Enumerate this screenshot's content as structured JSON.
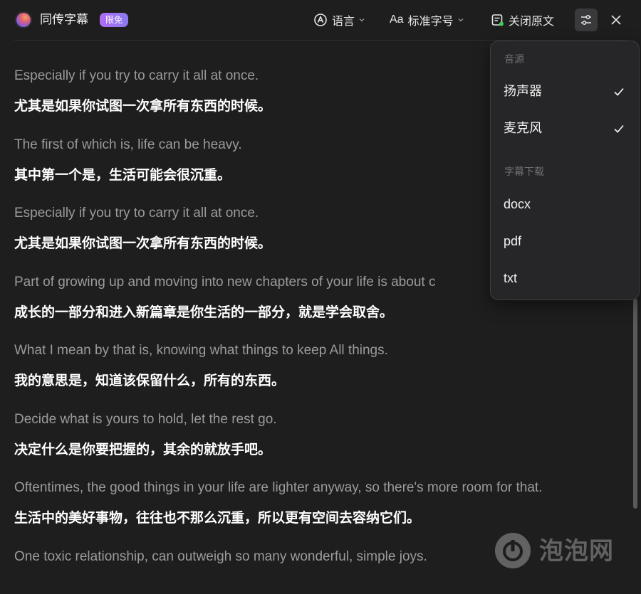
{
  "app": {
    "title": "同传字幕",
    "badge": "限免"
  },
  "toolbar": {
    "language_label": "语言",
    "font_size_label": "标准字号",
    "close_original_label": "关闭原文"
  },
  "subtitles": [
    {
      "en": "Especially if you try to carry it all at once.",
      "zh": "尤其是如果你试图一次拿所有东西的时候。"
    },
    {
      "en": "The first of which is, life can be heavy.",
      "zh": "其中第一个是，生活可能会很沉重。"
    },
    {
      "en": "Especially if you try to carry it all at once.",
      "zh": "尤其是如果你试图一次拿所有东西的时候。"
    },
    {
      "en": "Part of growing up and moving into new chapters of your life is about c",
      "zh": "成长的一部分和进入新篇章是你生活的一部分，就是学会取舍。"
    },
    {
      "en": "What I mean by that is, knowing what things to keep All things.",
      "zh": "我的意思是，知道该保留什么，所有的东西。"
    },
    {
      "en": "Decide what is yours to hold, let the rest go.",
      "zh": "决定什么是你要把握的，其余的就放手吧。"
    },
    {
      "en": "Oftentimes, the good things in your life are lighter anyway, so there's more room for that.",
      "zh": "生活中的美好事物，往往也不那么沉重，所以更有空间去容纳它们。"
    },
    {
      "en": "One toxic relationship, can outweigh so many wonderful, simple joys.",
      "zh": ""
    }
  ],
  "panel": {
    "audio_source_heading": "音源",
    "speaker_label": "扬声器",
    "speaker_checked": true,
    "mic_label": "麦克风",
    "mic_checked": true,
    "download_heading": "字幕下载",
    "docx_label": "docx",
    "pdf_label": "pdf",
    "txt_label": "txt"
  },
  "watermark": {
    "text": "泡泡网"
  },
  "colors": {
    "background": "#1e1e1f",
    "panel_background": "#262628",
    "badge_start": "#b06cf5",
    "badge_end": "#8a7af0",
    "status_dot": "#3ecf5a"
  },
  "icons": {
    "logo": "app-logo-icon",
    "language": "translate-icon",
    "font_size": "font-size-icon",
    "close_original": "document-icon",
    "settings": "sliders-icon",
    "close": "close-icon",
    "check": "check-icon"
  }
}
